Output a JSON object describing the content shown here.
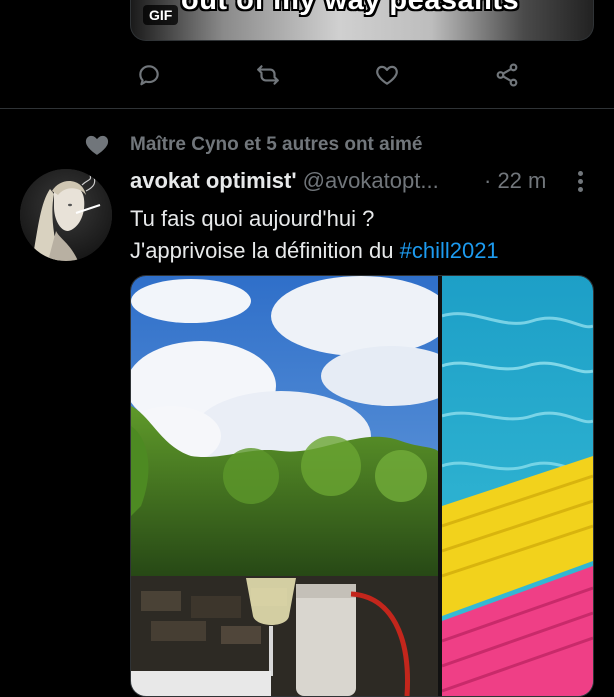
{
  "previous_tweet": {
    "gif_badge": "GIF",
    "gif_caption": "out of my way peasants",
    "actions": [
      {
        "name": "reply-icon"
      },
      {
        "name": "retweet-icon"
      },
      {
        "name": "like-icon"
      },
      {
        "name": "share-icon"
      }
    ]
  },
  "tweet": {
    "social_context": "Maître Cyno et 5 autres ont aimé",
    "social_icon": "heart-icon",
    "author_name": "avokat optimist'",
    "author_handle": "@avokatopt...",
    "timestamp": "· 22 m",
    "more_icon": "more-vertical-icon",
    "text_line1": "Tu fais quoi aujourd'hui ?",
    "text_line2_prefix": "J'apprivoise la définition du ",
    "hashtag": "#chill2021"
  },
  "colors": {
    "background": "#000000",
    "secondary_text": "#71767b",
    "link": "#1d9bf0",
    "divider": "#2f3336"
  }
}
